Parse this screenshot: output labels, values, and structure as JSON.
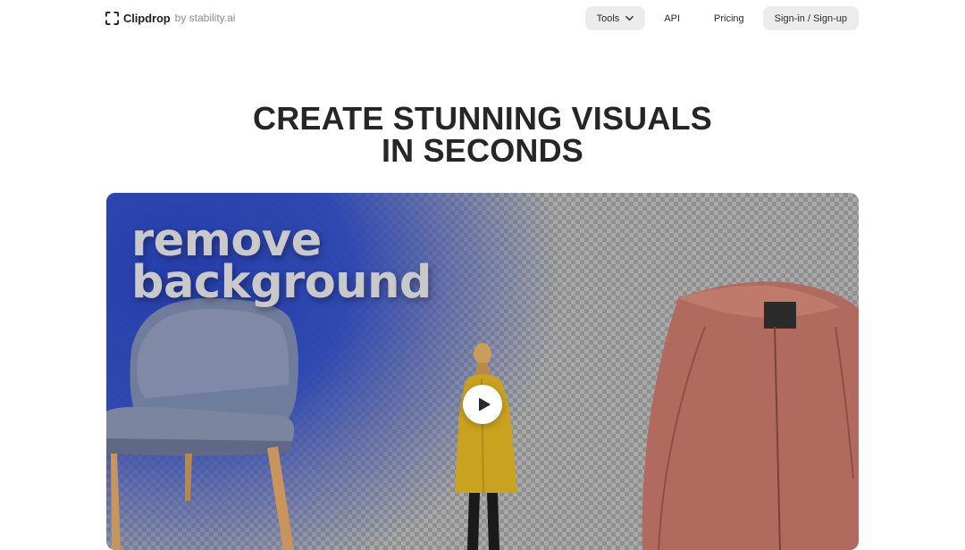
{
  "header": {
    "logo": {
      "name": "Clipdrop",
      "by": "by stability.ai",
      "icon": "clipdrop-logo-icon"
    },
    "nav": {
      "tools_label": "Tools",
      "tools_icon": "chevron-down-icon",
      "api_label": "API",
      "pricing_label": "Pricing",
      "signin_label": "Sign-in / Sign-up"
    }
  },
  "hero": {
    "title_line1": "CREATE STUNNING VISUALS",
    "title_line2": "IN SECONDS"
  },
  "media": {
    "overlay_line1": "remove",
    "overlay_line2": "background",
    "play_icon": "play-icon"
  },
  "colors": {
    "text": "#262626",
    "pill_bg": "#ececec",
    "media_blue": "#2a44b2",
    "jacket": "#b06b5e",
    "coat": "#c9a21f"
  }
}
